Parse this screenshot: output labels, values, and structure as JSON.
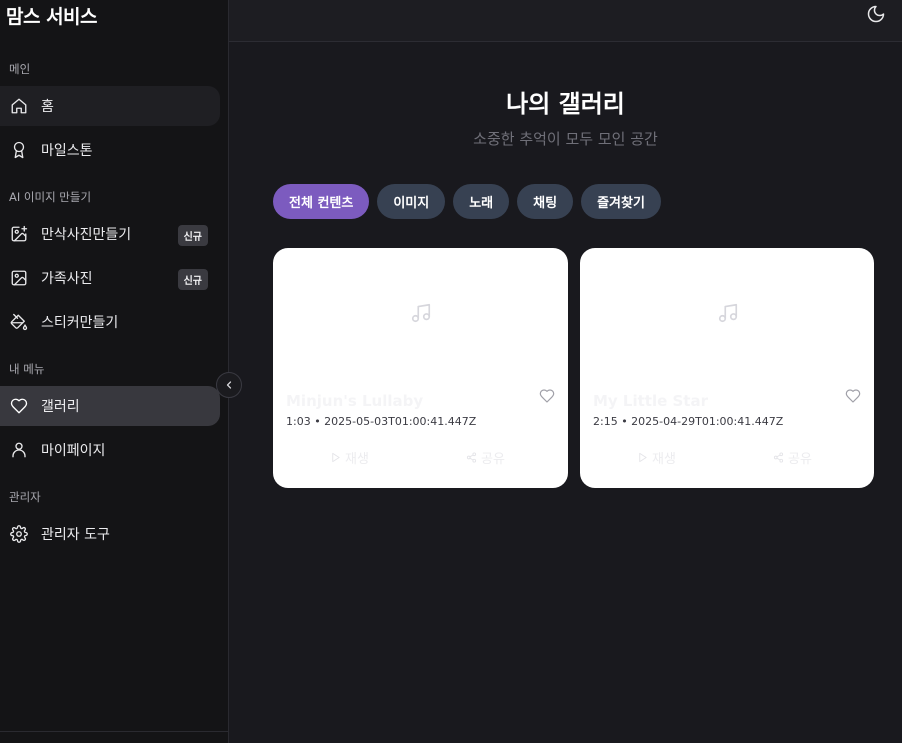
{
  "sidebar": {
    "brand": "맘스 서비스",
    "sections": {
      "main": "메인",
      "ai": "AI 이미지 만들기",
      "my": "내 메뉴",
      "admin": "관리자"
    },
    "items": {
      "home": "홈",
      "milestone": "마일스톤",
      "maternity": "만삭사진만들기",
      "family": "가족사진",
      "sticker": "스티커만들기",
      "gallery": "갤러리",
      "mypage": "마이페이지",
      "admin_tools": "관리자 도구"
    },
    "badges": {
      "maternity": "신규",
      "family": "신규"
    }
  },
  "main": {
    "title": "나의 갤러리",
    "subtitle": "소중한 추억이 모두 모인 공간",
    "filters": [
      "전체 컨텐츠",
      "이미지",
      "노래",
      "채팅",
      "즐겨찾기"
    ],
    "active_filter": "전체 컨텐츠"
  },
  "cards": [
    {
      "title": "Minjun's Lullaby",
      "meta": "1:03 • 2025-05-03T01:00:41.447Z",
      "play_label": "재생",
      "share_label": "공유"
    },
    {
      "title": "My Little Star",
      "meta": "2:15 • 2025-04-29T01:00:41.447Z",
      "play_label": "재생",
      "share_label": "공유"
    }
  ],
  "colors": {
    "accent": "#7c5bbf",
    "chip": "#374152",
    "background": "#19191e",
    "sidebar": "#141416"
  }
}
